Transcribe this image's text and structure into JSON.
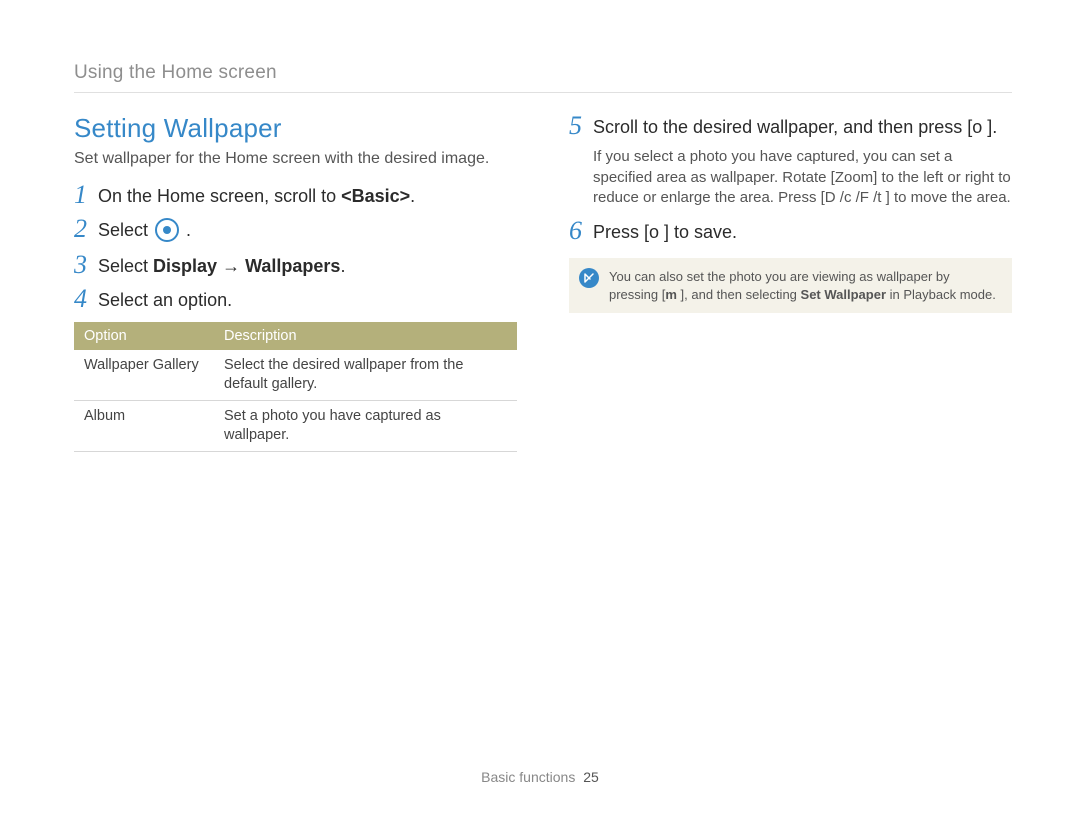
{
  "header": {
    "breadcrumb": "Using the Home screen"
  },
  "section": {
    "title": "Setting Wallpaper",
    "subtitle": "Set wallpaper for the Home screen with the desired image."
  },
  "steps": {
    "s1": {
      "num": "1",
      "pre": "On the Home screen, scroll to ",
      "bold": "<Basic>",
      "post": "."
    },
    "s2": {
      "num": "2",
      "pre": "Select ",
      "post": " ."
    },
    "s3": {
      "num": "3",
      "pre": "Select ",
      "b1": "Display",
      "arrow": " → ",
      "b2": "Wallpapers",
      "post": "."
    },
    "s4": {
      "num": "4",
      "text": "Select an option."
    },
    "s5": {
      "num": "5",
      "text": "Scroll to the desired wallpaper, and then press [o      ].",
      "sub_a": "If you select a photo you have captured, you can set a specified area as wallpaper. Rotate [",
      "sub_zoom": "Zoom",
      "sub_b": "] to the left or right to reduce or enlarge the area. Press [",
      "sub_d": "D",
      "sub_c": "      /c  /F /t     ] to move the area."
    },
    "s6": {
      "num": "6",
      "text": "Press [o      ] to save."
    }
  },
  "table": {
    "headers": {
      "option": "Option",
      "description": "Description"
    },
    "rows": [
      {
        "option": "Wallpaper Gallery",
        "description": "Select the desired wallpaper from the default gallery."
      },
      {
        "option": "Album",
        "description": "Set a photo you have captured as wallpaper."
      }
    ]
  },
  "note": {
    "pre": "You can also set the photo you are viewing as wallpaper by pressing [",
    "key": "m",
    "mid": "        ], and then selecting ",
    "bold": "Set Wallpaper",
    "post": " in Playback mode."
  },
  "footer": {
    "section": "Basic functions",
    "page": "25"
  }
}
